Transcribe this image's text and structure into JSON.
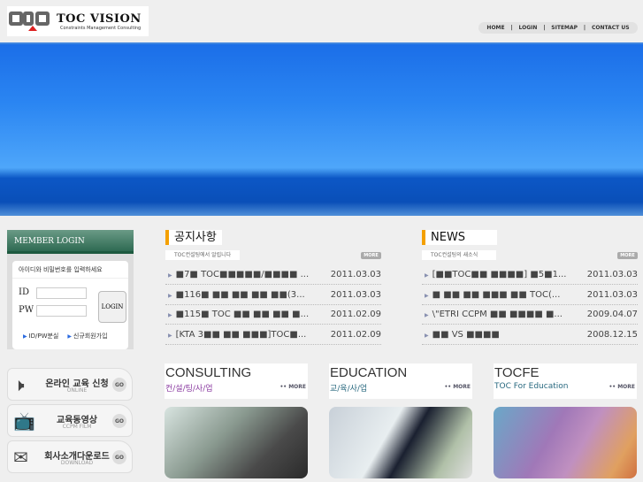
{
  "logo": {
    "title": "TOC VISION",
    "tagline": "Constraints Management Consulting"
  },
  "nav": [
    "HOME",
    "|",
    "LOGIN",
    "|",
    "SITEMAP",
    "|",
    "CONTACT US"
  ],
  "login": {
    "header": "MEMBER LOGIN",
    "message": "아이디와 비밀번호를 입력하세요",
    "id_label": "ID",
    "pw_label": "PW",
    "id_value": "",
    "pw_value": "",
    "button": "LOGIN",
    "find": "ID/PW분실",
    "join": "신규회원가입"
  },
  "quick": [
    {
      "ko": "온라인 교육 신청",
      "en": "ONLINE",
      "go": "GO",
      "icon": "speaker-icon"
    },
    {
      "ko": "교육동영상",
      "en": "CCPM FILM",
      "go": "GO",
      "icon": "tv-icon"
    },
    {
      "ko": "회사소개다운로드",
      "en": "DOWNLOAD",
      "go": "GO",
      "icon": "envelope-icon"
    }
  ],
  "notice": {
    "title": "공지사항",
    "sub": "TOC컨설팅에서 알립니다",
    "more": "MORE",
    "rows": [
      {
        "t": "■7■ TOC■■■■■/■■■■ ...",
        "d": "2011.03.03"
      },
      {
        "t": "■116■ ■■ ■■ ■■ ■■(3...",
        "d": "2011.03.03"
      },
      {
        "t": "■115■ TOC ■■ ■■ ■■ ■...",
        "d": "2011.02.09"
      },
      {
        "t": "[KTA 3■■ ■■ ■■■]TOC■...",
        "d": "2011.02.09"
      }
    ]
  },
  "news": {
    "title": "NEWS",
    "sub": "TOC컨설팅의 새소식",
    "more": "MORE",
    "rows": [
      {
        "t": "[■■TOC■■ ■■■■] ■5■1...",
        "d": "2011.03.03"
      },
      {
        "t": "■ ■■ ■■ ■■■ ■■ TOC(...",
        "d": "2011.03.03"
      },
      {
        "t": "\\\"ETRI CCPM ■■ ■■■■ ■...",
        "d": "2009.04.07"
      },
      {
        "t": "■■ VS ■■■■",
        "d": "2008.12.15"
      }
    ]
  },
  "cards": [
    {
      "title": "CONSULTING",
      "sub": "컨/설/팅/사/업",
      "more": "•• MORE",
      "color": "#8a3aa0"
    },
    {
      "title": "EDUCATION",
      "sub": "교/육/사/업",
      "more": "•• MORE",
      "color": "#2a6a80"
    },
    {
      "title": "TOCFE",
      "sub": "TOC For Education",
      "more": "•• MORE",
      "color": "#2a6a80"
    }
  ]
}
